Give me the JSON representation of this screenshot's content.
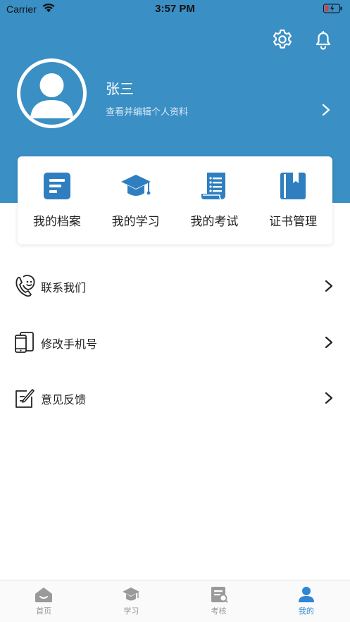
{
  "status_bar": {
    "carrier": "Carrier",
    "time": "3:57 PM"
  },
  "profile": {
    "name": "张三",
    "subtitle": "查看并编辑个人资料"
  },
  "quick_actions": [
    {
      "label": "我的档案",
      "icon": "file-icon"
    },
    {
      "label": "我的学习",
      "icon": "graduation-cap-icon"
    },
    {
      "label": "我的考试",
      "icon": "scroll-icon"
    },
    {
      "label": "证书管理",
      "icon": "book-icon"
    }
  ],
  "menu": [
    {
      "label": "联系我们",
      "icon": "contact-phone-icon"
    },
    {
      "label": "修改手机号",
      "icon": "phone-icon"
    },
    {
      "label": "意见反馈",
      "icon": "feedback-edit-icon"
    }
  ],
  "tabbar": [
    {
      "label": "首页",
      "icon": "home-icon",
      "active": false
    },
    {
      "label": "学习",
      "icon": "graduation-cap-icon",
      "active": false
    },
    {
      "label": "考核",
      "icon": "exam-icon",
      "active": false
    },
    {
      "label": "我的",
      "icon": "user-icon",
      "active": true
    }
  ],
  "colors": {
    "header": "#3a8fc4",
    "accent": "#2f86d6",
    "tab_inactive": "#9a9a9a"
  }
}
